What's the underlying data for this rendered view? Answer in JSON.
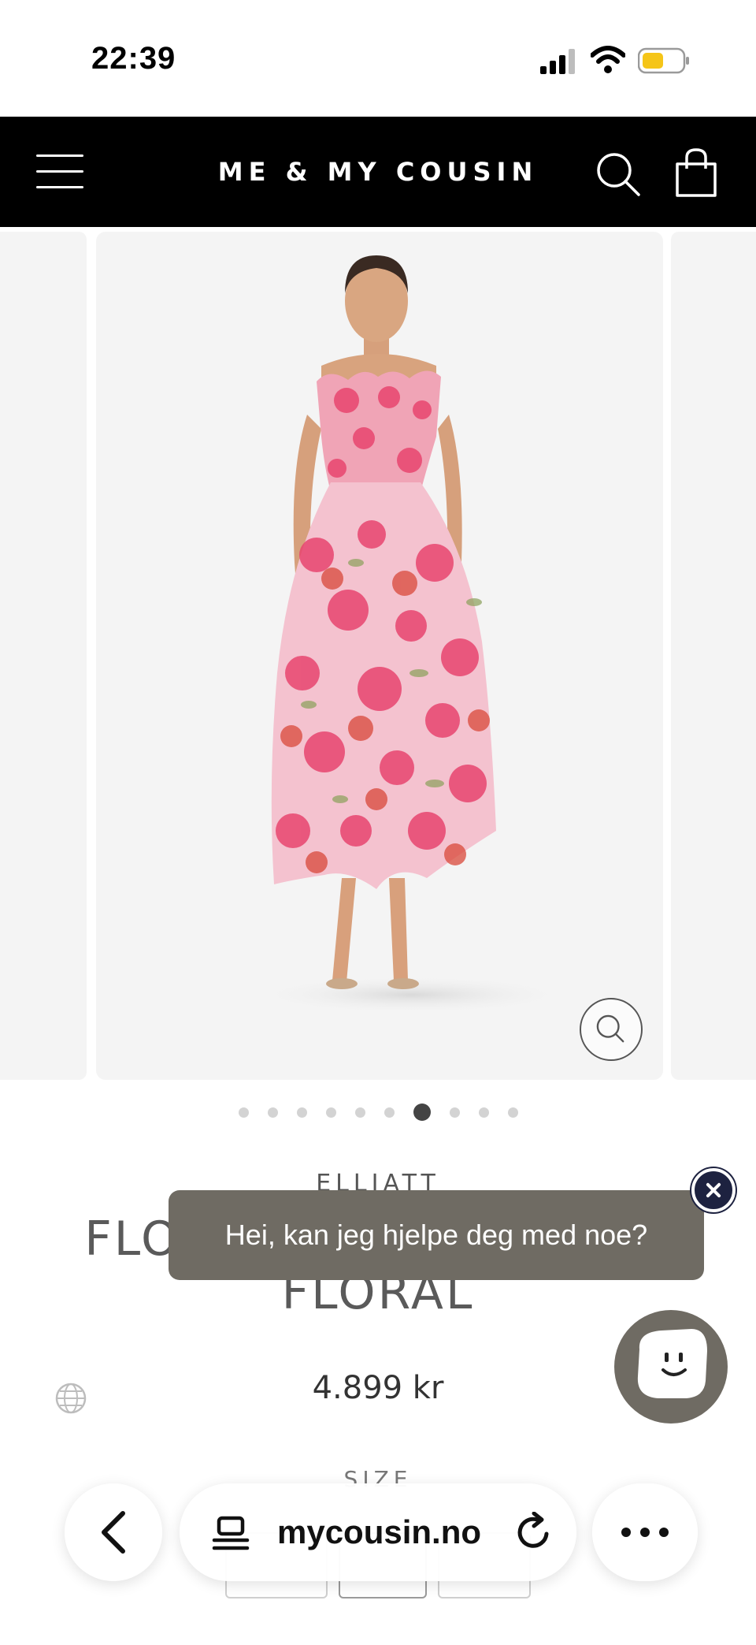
{
  "status_bar": {
    "time": "22:39"
  },
  "header": {
    "brand": "ME & MY COUSIN"
  },
  "gallery": {
    "total_images": 10,
    "active_index": 6
  },
  "product": {
    "brand": "ELLIATT",
    "title": "FLORENCE GOWN PINK FLORAL",
    "price": "4.899 kr",
    "size_label": "SIZE"
  },
  "chat": {
    "message": "Hei, kan jeg hjelpe deg med noe?"
  },
  "browser": {
    "url": "mycousin.no"
  },
  "colors": {
    "header_bg": "#000000",
    "chat_bg": "#6f6b63",
    "chat_close": "#1d2240",
    "battery": "#f5c518",
    "dress_base": "#f4c2cf",
    "dress_flower": "#e8456f"
  }
}
